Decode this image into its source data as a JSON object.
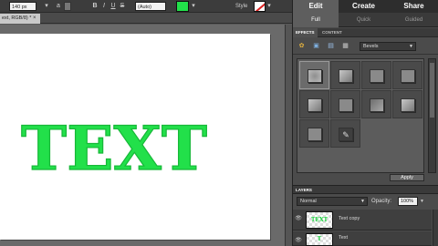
{
  "options_bar": {
    "font_size": "140 px",
    "aa_icon": "a",
    "anti_alias": "(Auto)",
    "style_label": "Style",
    "color_value": "#22e04a",
    "bold_icon": "B",
    "italic_icon": "I",
    "underline_icon": "U",
    "strike_icon": "S"
  },
  "document": {
    "tab_title": "ext, RGB/8) *",
    "tab_close": "×",
    "canvas_text": "TEXT",
    "text_color": "#22e04a"
  },
  "modes": {
    "edit": "Edit",
    "create": "Create",
    "share": "Share"
  },
  "edit_modes": {
    "full": "Full",
    "quick": "Quick",
    "guided": "Guided"
  },
  "effects_panel": {
    "tab_effects": "EFFECTS",
    "tab_content": "CONTENT",
    "category": "Bevels",
    "apply": "Apply"
  },
  "layers_panel": {
    "title": "LAYERS",
    "blend_mode": "Normal",
    "opacity_label": "Opacity:",
    "opacity_value": "100%",
    "layers": [
      {
        "name": "Text copy",
        "thumb": "TEXT"
      },
      {
        "name": "Text",
        "thumb": "T"
      }
    ]
  }
}
